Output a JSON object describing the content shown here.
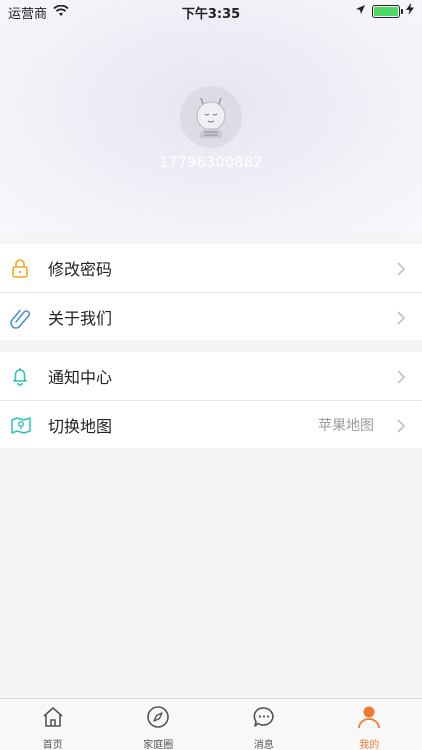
{
  "status_bar": {
    "carrier": "运营商",
    "time": "下午3:35"
  },
  "profile": {
    "phone": "17796300882"
  },
  "menu_groups": [
    [
      {
        "label": "修改密码",
        "icon": "lock-icon",
        "value": ""
      },
      {
        "label": "关于我们",
        "icon": "paperclip-icon",
        "value": ""
      }
    ],
    [
      {
        "label": "通知中心",
        "icon": "bell-icon",
        "value": ""
      },
      {
        "label": "切换地图",
        "icon": "map-icon",
        "value": "苹果地图"
      }
    ]
  ],
  "tabbar": {
    "items": [
      {
        "label": "首页",
        "icon": "home-icon"
      },
      {
        "label": "家庭圈",
        "icon": "compass-icon"
      },
      {
        "label": "消息",
        "icon": "message-icon"
      },
      {
        "label": "我的",
        "icon": "person-icon",
        "active": true
      }
    ]
  },
  "colors": {
    "accent": "#f07a30",
    "lock": "#f5a623",
    "clip": "#4a90d9",
    "teal": "#2ec4b6"
  }
}
